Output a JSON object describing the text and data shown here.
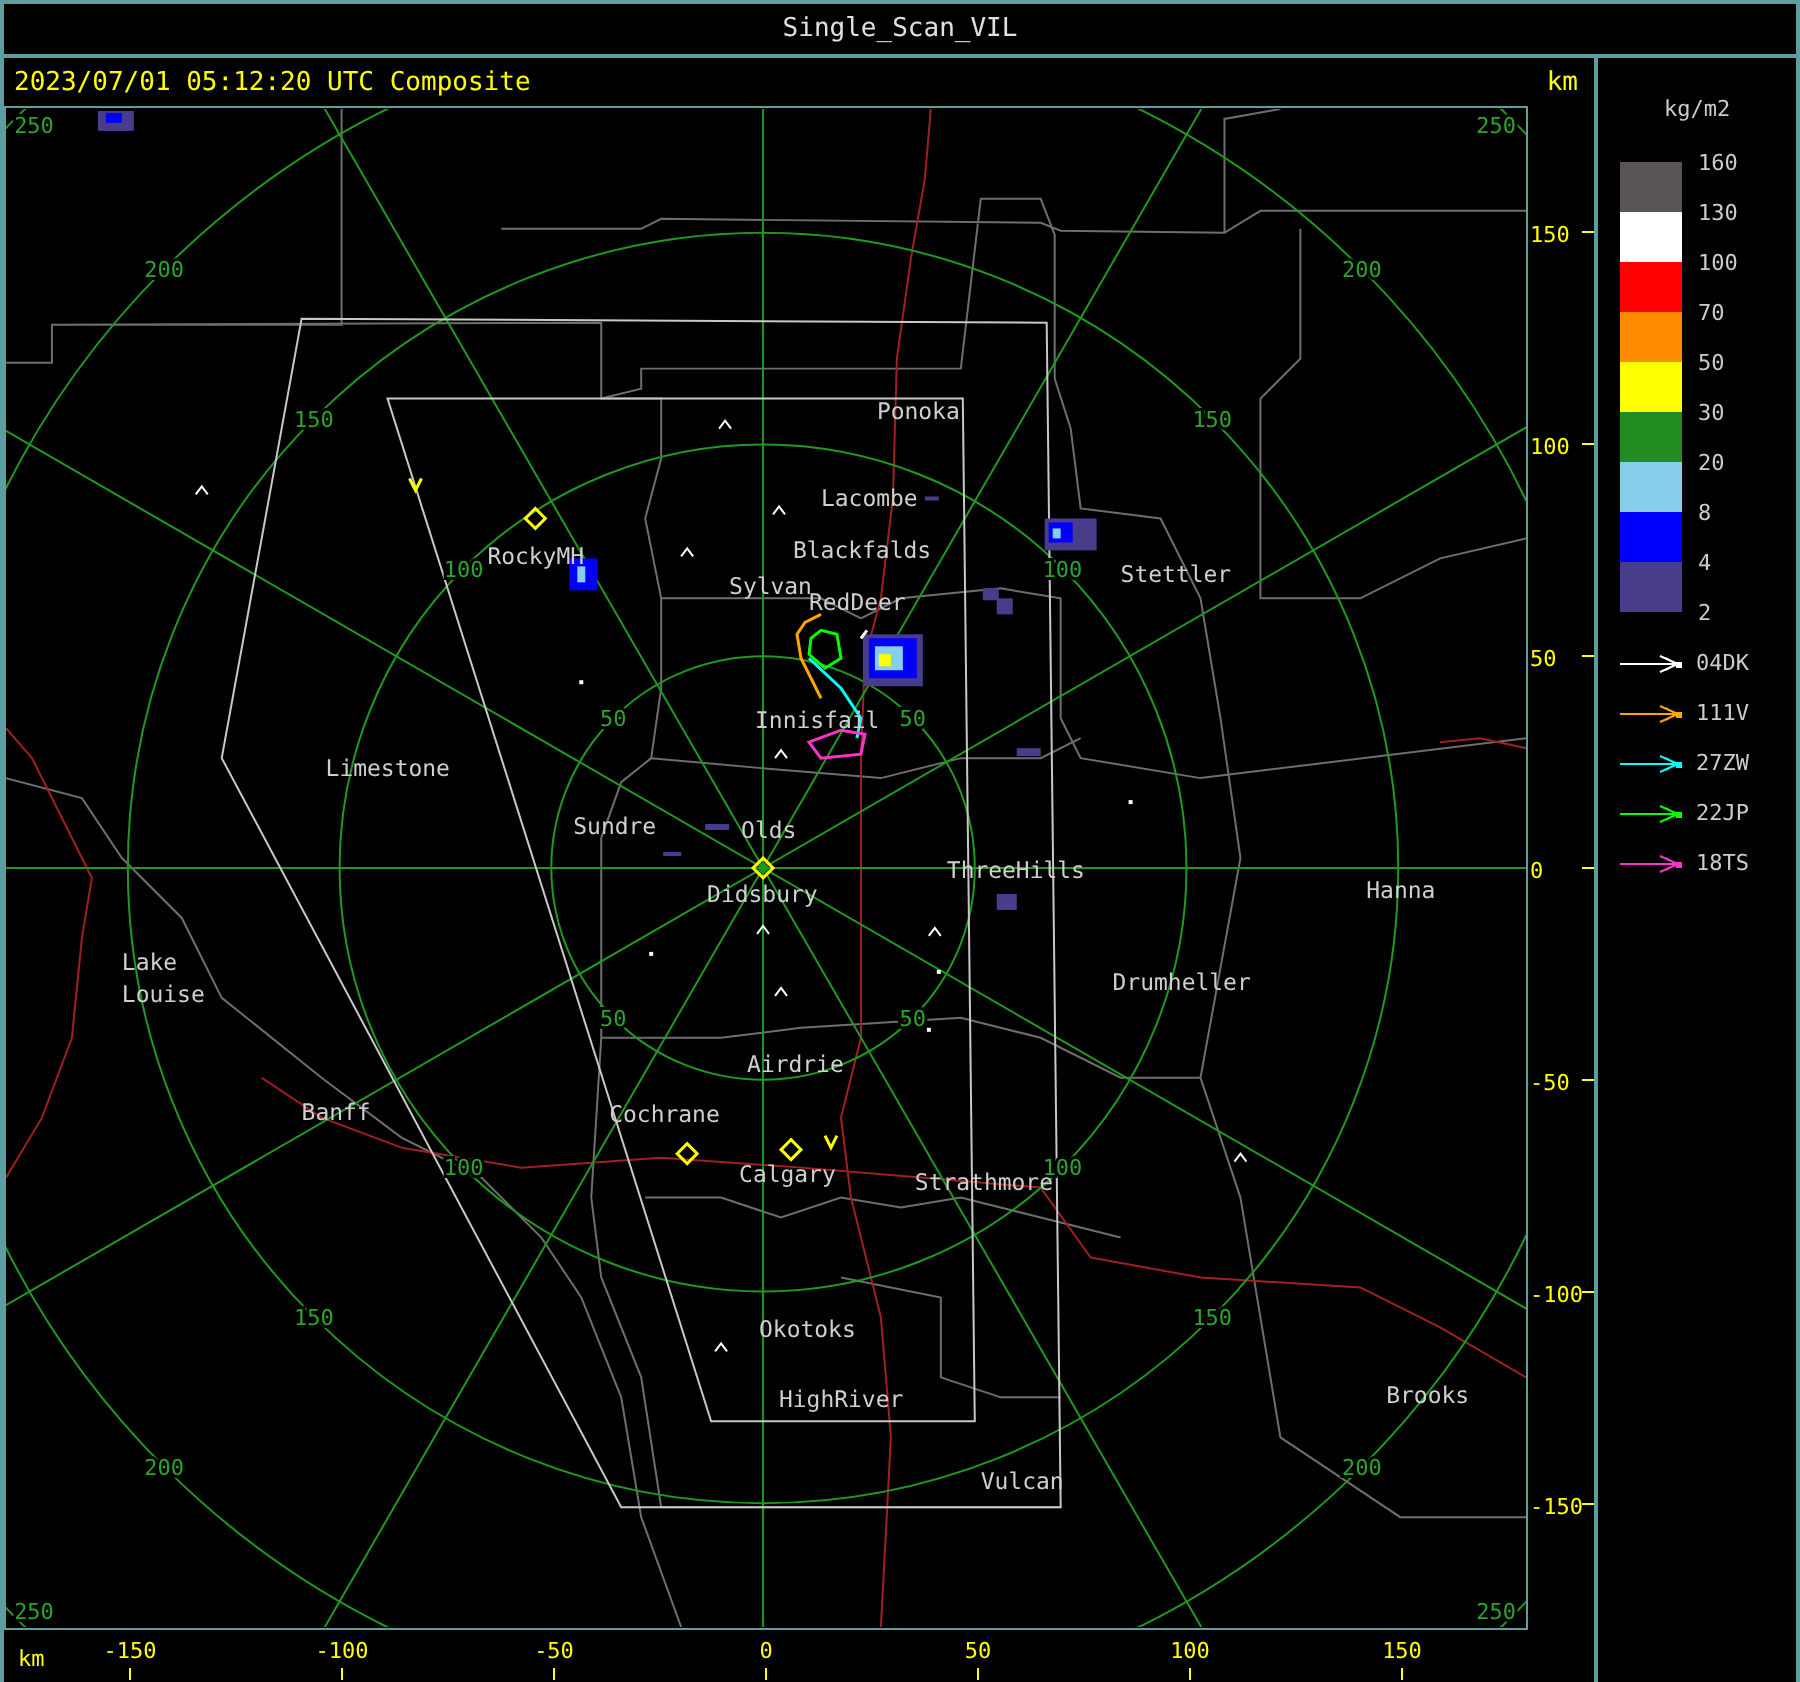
{
  "window": {
    "title": "Single_Scan_VIL"
  },
  "header": {
    "timestamp": "2023/07/01 05:12:20 UTC Composite",
    "axis_unit": "km"
  },
  "y_axis": {
    "ticks": [
      "150",
      "100",
      "50",
      "0",
      "-50",
      "-100",
      "-150"
    ]
  },
  "x_axis": {
    "unit": "km",
    "ticks": [
      "-150",
      "-100",
      "-50",
      "0",
      "50",
      "100",
      "150"
    ]
  },
  "range_rings": [
    {
      "labels": [
        "50",
        "50",
        "50",
        "50"
      ]
    },
    {
      "labels": [
        "100",
        "100",
        "100",
        "100"
      ]
    },
    {
      "labels": [
        "150",
        "150",
        "150",
        "150"
      ]
    },
    {
      "labels": [
        "200",
        "200",
        "200",
        "200"
      ]
    },
    {
      "labels": [
        "250",
        "250",
        "250",
        "250"
      ]
    }
  ],
  "places": [
    {
      "name": "Ponoka"
    },
    {
      "name": "Lacombe"
    },
    {
      "name": "Blackfalds"
    },
    {
      "name": "Stettler"
    },
    {
      "name": "Sylvan"
    },
    {
      "name": "RedDeer"
    },
    {
      "name": "RockyMH"
    },
    {
      "name": "Innisfail"
    },
    {
      "name": "Limestone"
    },
    {
      "name": "Sundre"
    },
    {
      "name": "Olds"
    },
    {
      "name": "Didsbury"
    },
    {
      "name": "ThreeHills"
    },
    {
      "name": "Hanna"
    },
    {
      "name": "Lake"
    },
    {
      "name": "Louise"
    },
    {
      "name": "Drumheller"
    },
    {
      "name": "Airdrie"
    },
    {
      "name": "Banff"
    },
    {
      "name": "Cochrane"
    },
    {
      "name": "Calgary"
    },
    {
      "name": "Strathmore"
    },
    {
      "name": "Okotoks"
    },
    {
      "name": "HighRiver"
    },
    {
      "name": "Brooks"
    },
    {
      "name": "Vulcan"
    }
  ],
  "legend": {
    "unit": "kg/m2",
    "labels": [
      "160",
      "130",
      "100",
      "70",
      "50",
      "30",
      "20",
      "8",
      "4",
      "2"
    ],
    "bins": [
      {
        "color": "#595555"
      },
      {
        "color": "#ffffff"
      },
      {
        "color": "#ff0000"
      },
      {
        "color": "#ff8c00"
      },
      {
        "color": "#ffff00"
      },
      {
        "color": "#228b22"
      },
      {
        "color": "#87ceeb"
      },
      {
        "color": "#0000ff"
      },
      {
        "color": "#483d8b"
      }
    ]
  },
  "tracks": [
    {
      "label": "04DK",
      "color": "#ffffff"
    },
    {
      "label": "111V",
      "color": "#ffa500"
    },
    {
      "label": "27ZW",
      "color": "#00ffff"
    },
    {
      "label": "22JP",
      "color": "#00ff00"
    },
    {
      "label": "18TS",
      "color": "#ff33cc"
    }
  ]
}
